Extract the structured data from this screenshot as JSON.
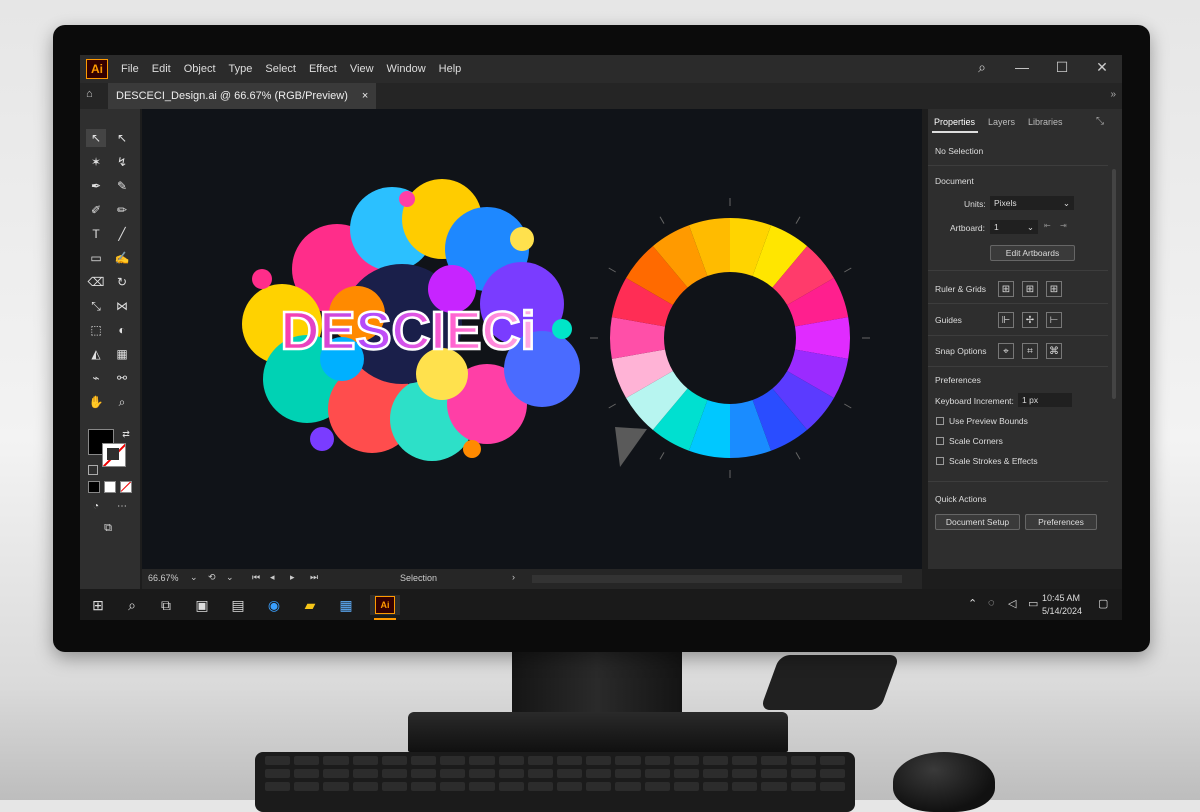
{
  "app": {
    "logo": "Ai",
    "menu": [
      "File",
      "Edit",
      "Object",
      "Type",
      "Select",
      "Effect",
      "View",
      "Window",
      "Help"
    ],
    "window_controls": [
      "search-icon",
      "minimize-icon",
      "maximize-icon",
      "close-icon"
    ]
  },
  "document_tab": {
    "title": "DESCECI_Design.ai @ 66.67% (RGB/Preview)",
    "close": "×"
  },
  "canvas": {
    "artwork_text": "DESCIECi",
    "colors": {
      "canvas_bg": "#101318",
      "accent": "#ff9a00"
    }
  },
  "panel": {
    "tabs": [
      "Properties",
      "Layers",
      "Libraries"
    ],
    "selection_status": "No Selection",
    "document_heading": "Document",
    "units_label": "Units:",
    "units_value": "Pixels",
    "artboard_label": "Artboard:",
    "artboard_value": "1",
    "edit_artboards": "Edit Artboards",
    "ruler_grids": "Ruler & Grids",
    "guides": "Guides",
    "snap_options": "Snap Options",
    "preferences_heading": "Preferences",
    "keyboard_increment_label": "Keyboard Increment:",
    "keyboard_increment_value": "1 px",
    "checkboxes": [
      "Use Preview Bounds",
      "Scale Corners",
      "Scale Strokes & Effects"
    ],
    "quick_actions": "Quick Actions",
    "document_setup": "Document Setup",
    "preferences_button": "Preferences"
  },
  "status_bar": {
    "zoom": "66.67%",
    "tool": "Selection"
  },
  "taskbar": {
    "time": "10:45 AM",
    "date": "5/14/2024",
    "app_label": "Ai"
  }
}
